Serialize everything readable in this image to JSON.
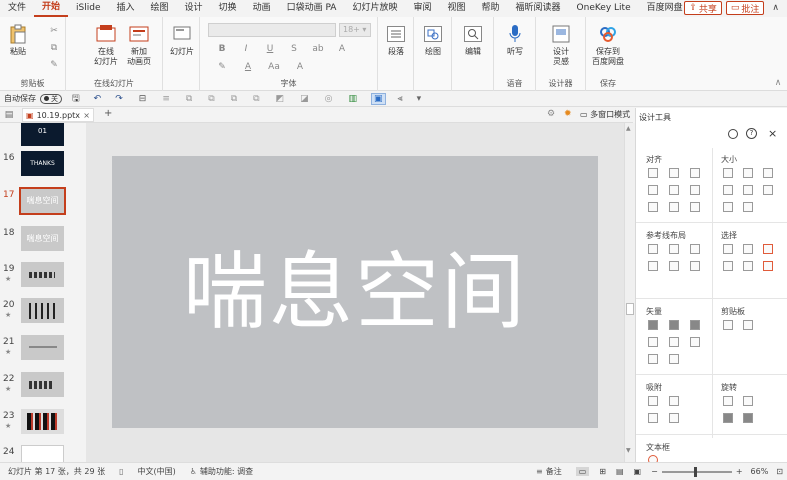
{
  "menu": {
    "items": [
      "文件",
      "开始",
      "iSlide",
      "插入",
      "绘图",
      "设计",
      "切换",
      "动画",
      "口袋动画 PA",
      "幻灯片放映",
      "审阅",
      "视图",
      "帮助",
      "福昕阅读器",
      "OneKey Lite",
      "百度网盘"
    ],
    "active_index": 1,
    "share_label": "共享",
    "comment_label": "批注"
  },
  "ribbon": {
    "clipboard": {
      "paste": "粘贴",
      "group": "剪贴板"
    },
    "online": {
      "btn1": "在线\n幻灯片",
      "btn2": "新加\n动画页",
      "group": "在线幻灯片"
    },
    "slides": {
      "label": "幻灯片"
    },
    "font": {
      "group": "字体",
      "size_value": "18+"
    },
    "paragraph": {
      "label": "段落"
    },
    "drawing": {
      "label": "绘图"
    },
    "editing": {
      "label": "编辑"
    },
    "voice": {
      "btn": "听写",
      "group": "语音"
    },
    "designer": {
      "btn": "设计\n灵感",
      "group": "设计器"
    },
    "save": {
      "btn": "保存到\n百度网盘",
      "group": "保存"
    }
  },
  "qat": {
    "autosave_label": "自动保存",
    "autosave_state": "关"
  },
  "tab": {
    "filename": "10.19.pptx",
    "add_label": "+",
    "window_mode": "多窗口模式"
  },
  "thumbnails": [
    {
      "num": "",
      "text": "01",
      "dark": true
    },
    {
      "num": "16",
      "text": "THANKS",
      "dark": true
    },
    {
      "num": "17",
      "text": "喘息空间",
      "dark": false,
      "selected": true
    },
    {
      "num": "18",
      "text": "喘息空间",
      "dark": false
    },
    {
      "num": "19",
      "text": "",
      "dark": false
    },
    {
      "num": "20",
      "text": "",
      "dark": false
    },
    {
      "num": "21",
      "text": "",
      "dark": false
    },
    {
      "num": "22",
      "text": "",
      "dark": false
    },
    {
      "num": "23",
      "text": "",
      "dark": false
    },
    {
      "num": "24",
      "text": "",
      "dark": false
    }
  ],
  "slide": {
    "title": "喘息空间",
    "bg_color": "#bfc1c4"
  },
  "pane": {
    "title": "设计工具",
    "sections": {
      "align": "对齐",
      "size": "大小",
      "guides": "参考线布局",
      "select": "选择",
      "vector": "矢量",
      "clipboard": "剪贴板",
      "snap": "吸附",
      "rotate": "旋转",
      "textbox": "文本框"
    }
  },
  "status": {
    "slide_info": "幻灯片 第 17 张，共 29 张",
    "language": "中文(中国)",
    "accessibility": "辅助功能: 调查",
    "notes": "备注",
    "zoom": "66%"
  },
  "colors": {
    "accent": "#c43e1c",
    "slide_bg": "#bfc1c4",
    "dark_thumb": "#0b1a2e"
  }
}
